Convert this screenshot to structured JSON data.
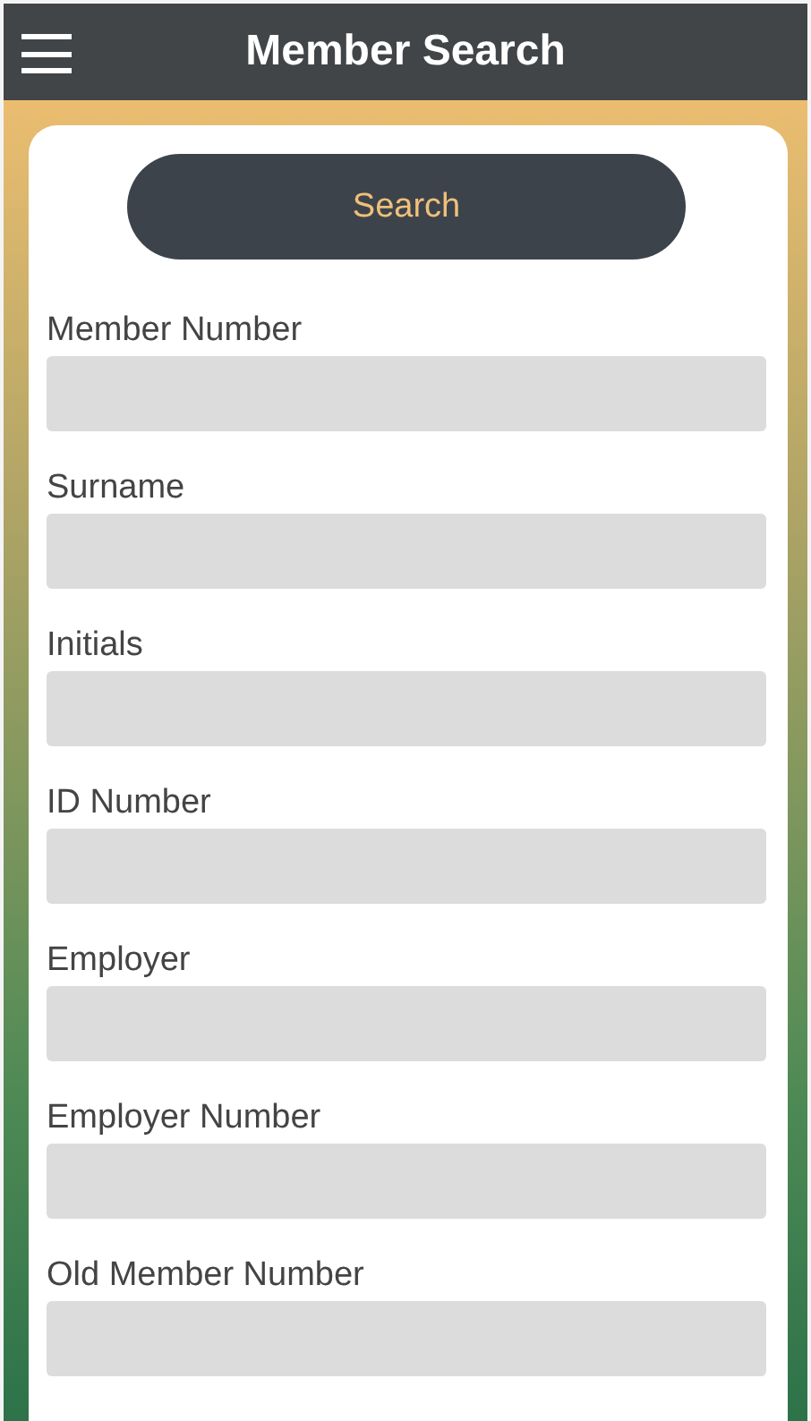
{
  "header": {
    "title": "Member Search"
  },
  "search_button": {
    "label": "Search"
  },
  "fields": [
    {
      "label": "Member Number"
    },
    {
      "label": "Surname"
    },
    {
      "label": "Initials"
    },
    {
      "label": "ID Number"
    },
    {
      "label": "Employer"
    },
    {
      "label": "Employer Number"
    },
    {
      "label": "Old Member Number"
    }
  ]
}
